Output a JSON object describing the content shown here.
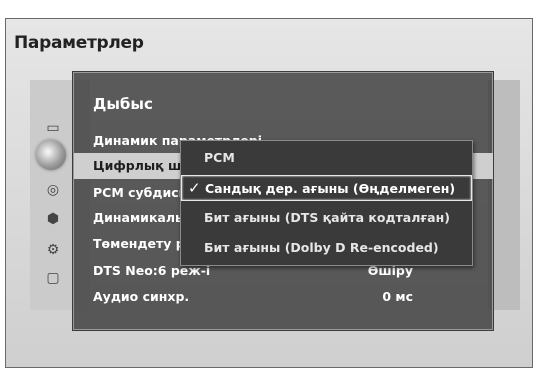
{
  "window": {
    "title": "Параметрлер"
  },
  "side_icons": [
    {
      "name": "picture-icon",
      "glyph": "▭"
    },
    {
      "name": "sound-icon",
      "glyph": ""
    },
    {
      "name": "broadcast-icon",
      "glyph": "◎"
    },
    {
      "name": "network-icon",
      "glyph": "⬢"
    },
    {
      "name": "system-icon",
      "glyph": "⚙"
    },
    {
      "name": "support-icon",
      "glyph": "▢"
    }
  ],
  "sound_menu": {
    "title": "Дыбыс",
    "items": [
      {
        "label": "Динамик параметрлері",
        "value": ""
      },
      {
        "label": "Цифрлық шығыс",
        "value": ""
      },
      {
        "label": "PCM субдискр.",
        "value": ""
      },
      {
        "label": "Динамикалық ауқым",
        "value": ""
      },
      {
        "label": "Төмендету режимі",
        "value": ""
      },
      {
        "label": "DTS Neo:6 реж-і",
        "value": "Өшіру"
      },
      {
        "label": "Аудио синхр.",
        "value": "0 мс"
      }
    ]
  },
  "dropdown": {
    "options": [
      {
        "label": "PCM",
        "checked": false
      },
      {
        "label": "Сандық дер. ағыны (Өңделмеген)",
        "checked": true
      },
      {
        "label": "Бит ағыны (DTS қайта кодталған)",
        "checked": false
      },
      {
        "label": "Бит ағыны (Dolby D Re-encoded)",
        "checked": false
      }
    ],
    "check_glyph": "✓"
  },
  "colors": {
    "panel": "#3c3c3c",
    "selected_row": "#cfcfcf"
  }
}
